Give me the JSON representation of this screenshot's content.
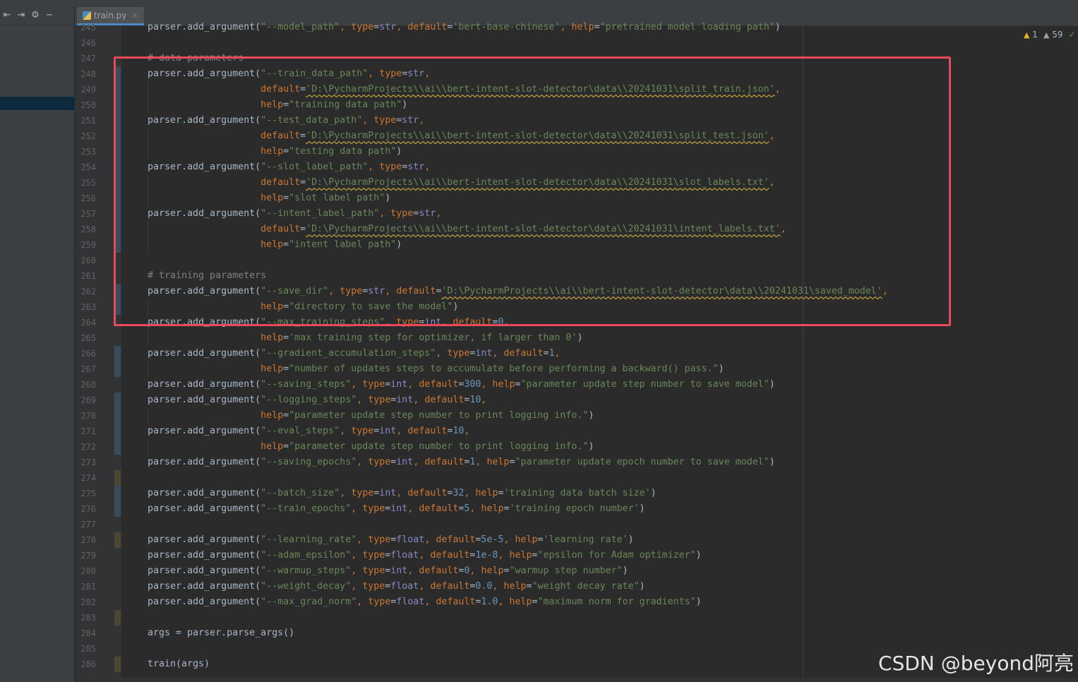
{
  "window": {
    "tab": {
      "filename": "train.py",
      "close_glyph": "×"
    },
    "toolbar_icons": [
      "collapse-all-icon",
      "expand-all-icon",
      "gear-icon",
      "minimize-icon"
    ]
  },
  "editor": {
    "inspections": {
      "warnings": "1",
      "weak_warnings": "59"
    },
    "lines": [
      {
        "n": "245",
        "text": "parser.add_argument(\"--model_path\", type=str, default='bert-base-chinese', help=\"pretrained model loading path\")"
      },
      {
        "n": "246",
        "text": ""
      },
      {
        "n": "247",
        "text": "# data parameters"
      },
      {
        "n": "248",
        "text": "parser.add_argument(\"--train_data_path\", type=str,"
      },
      {
        "n": "249",
        "text": "                    default='D:\\PycharmProjects\\\\ai\\\\bert-intent-slot-detector\\data\\\\20241031\\split_train.json',"
      },
      {
        "n": "250",
        "text": "                    help=\"training data path\")"
      },
      {
        "n": "251",
        "text": "parser.add_argument(\"--test_data_path\", type=str,"
      },
      {
        "n": "252",
        "text": "                    default='D:\\PycharmProjects\\\\ai\\\\bert-intent-slot-detector\\data\\\\20241031\\split_test.json',"
      },
      {
        "n": "253",
        "text": "                    help=\"testing data path\")"
      },
      {
        "n": "254",
        "text": "parser.add_argument(\"--slot_label_path\", type=str,"
      },
      {
        "n": "255",
        "text": "                    default='D:\\PycharmProjects\\\\ai\\\\bert-intent-slot-detector\\data\\\\20241031\\slot_labels.txt',"
      },
      {
        "n": "256",
        "text": "                    help=\"slot label path\")"
      },
      {
        "n": "257",
        "text": "parser.add_argument(\"--intent_label_path\", type=str,"
      },
      {
        "n": "258",
        "text": "                    default='D:\\PycharmProjects\\\\ai\\\\bert-intent-slot-detector\\data\\\\20241031\\intent_labels.txt',"
      },
      {
        "n": "259",
        "text": "                    help=\"intent label path\")"
      },
      {
        "n": "260",
        "text": ""
      },
      {
        "n": "261",
        "text": "# training parameters"
      },
      {
        "n": "262",
        "text": "parser.add_argument(\"--save_dir\", type=str, default='D:\\PycharmProjects\\\\ai\\\\bert-intent-slot-detector\\data\\\\20241031\\saved_model',"
      },
      {
        "n": "263",
        "text": "                    help=\"directory to save the model\")"
      },
      {
        "n": "264",
        "text": "parser.add_argument(\"--max_training_steps\", type=int, default=0,"
      },
      {
        "n": "265",
        "text": "                    help='max training step for optimizer, if larger than 0')"
      },
      {
        "n": "266",
        "text": "parser.add_argument(\"--gradient_accumulation_steps\", type=int, default=1,"
      },
      {
        "n": "267",
        "text": "                    help=\"number of updates steps to accumulate before performing a backward() pass.\")"
      },
      {
        "n": "268",
        "text": "parser.add_argument(\"--saving_steps\", type=int, default=300, help=\"parameter update step number to save model\")"
      },
      {
        "n": "269",
        "text": "parser.add_argument(\"--logging_steps\", type=int, default=10,"
      },
      {
        "n": "270",
        "text": "                    help=\"parameter update step number to print logging info.\")"
      },
      {
        "n": "271",
        "text": "parser.add_argument(\"--eval_steps\", type=int, default=10,"
      },
      {
        "n": "272",
        "text": "                    help=\"parameter update step number to print logging info.\")"
      },
      {
        "n": "273",
        "text": "parser.add_argument(\"--saving_epochs\", type=int, default=1, help=\"parameter update epoch number to save model\")"
      },
      {
        "n": "274",
        "text": ""
      },
      {
        "n": "275",
        "text": "parser.add_argument(\"--batch_size\", type=int, default=32, help='training data batch size')"
      },
      {
        "n": "276",
        "text": "parser.add_argument(\"--train_epochs\", type=int, default=5, help='training epoch number')"
      },
      {
        "n": "277",
        "text": ""
      },
      {
        "n": "278",
        "text": "parser.add_argument(\"--learning_rate\", type=float, default=5e-5, help='learning rate')"
      },
      {
        "n": "279",
        "text": "parser.add_argument(\"--adam_epsilon\", type=float, default=1e-8, help=\"epsilon for Adam optimizer\")"
      },
      {
        "n": "280",
        "text": "parser.add_argument(\"--warmup_steps\", type=int, default=0, help=\"warmup step number\")"
      },
      {
        "n": "281",
        "text": "parser.add_argument(\"--weight_decay\", type=float, default=0.0, help=\"weight decay rate\")"
      },
      {
        "n": "282",
        "text": "parser.add_argument(\"--max_grad_norm\", type=float, default=1.0, help=\"maximum norm for gradients\")"
      },
      {
        "n": "283",
        "text": ""
      },
      {
        "n": "284",
        "text": "args = parser.parse_args()"
      },
      {
        "n": "285",
        "text": ""
      },
      {
        "n": "286",
        "text": "train(args)"
      }
    ]
  },
  "watermark": "CSDN @beyond阿亮",
  "colors": {
    "background": "#2b2b2b",
    "keyword": "#cc7832",
    "string": "#6a8759",
    "number": "#6897bb",
    "comment": "#808080",
    "builtin": "#8888c6",
    "annotation_box": "#e8495b"
  }
}
